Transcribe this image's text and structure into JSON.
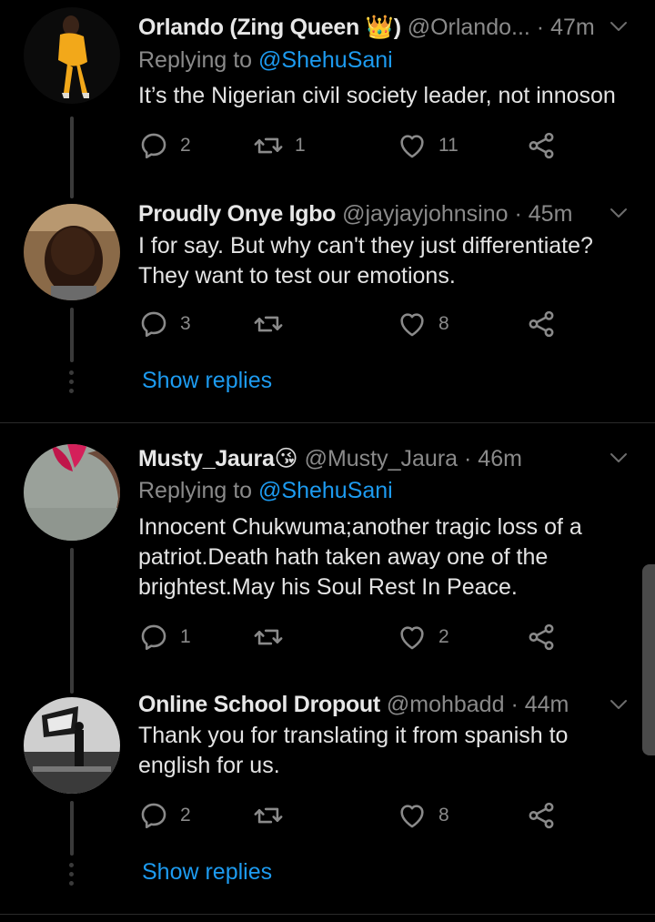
{
  "tweets": [
    {
      "name": "Orlando (Zing Queen ",
      "name_suffix": ")",
      "badge": "👑",
      "handle": "@Orlando...",
      "time": "· 47m",
      "replying_prefix": "Replying to ",
      "replying_to": "@ShehuSani",
      "text": "It’s the Nigerian civil society leader, not innoson",
      "replies": "2",
      "retweets": "1",
      "likes": "11"
    },
    {
      "name": "Proudly Onye Igbo",
      "handle": "@jayjayjohnsino",
      "time": "· 45m",
      "text_lines": [
        "I for say. But why can't they just differentiate?",
        "They want to test our emotions."
      ],
      "replies": "3",
      "retweets": "",
      "likes": "8"
    },
    {
      "name": "Musty_Jaura",
      "badge": "😘",
      "handle": "@Musty_Jaura",
      "time": "· 46m",
      "replying_prefix": "Replying to ",
      "replying_to": "@ShehuSani",
      "text_lines": [
        "Innocent Chukwuma;another tragic loss of a",
        "patriot.Death hath taken away one of the",
        "brightest.May his Soul Rest In Peace."
      ],
      "replies": "1",
      "retweets": "",
      "likes": "2"
    },
    {
      "name": "Online School Dropout",
      "handle": "@mohbadd",
      "time": "· 44m",
      "text_lines": [
        "Thank you for translating it from spanish to",
        "english for us."
      ],
      "replies": "2",
      "retweets": "",
      "likes": "8"
    }
  ],
  "show_replies_label": "Show replies",
  "icons": {
    "reply": "reply-icon",
    "retweet": "retweet-icon",
    "like": "heart-icon",
    "share": "share-icon",
    "more": "chevron-down-icon"
  },
  "colors": {
    "background": "#000000",
    "link": "#1d9bf0",
    "muted": "#8a8a8a"
  }
}
